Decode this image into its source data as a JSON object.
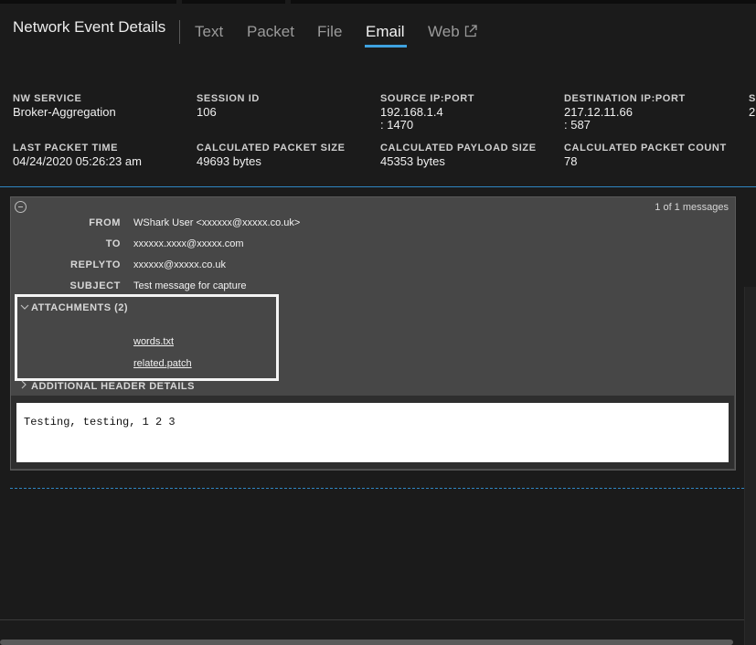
{
  "header": {
    "title": "Network Event Details",
    "tabs": [
      {
        "label": "Text",
        "active": false
      },
      {
        "label": "Packet",
        "active": false
      },
      {
        "label": "File",
        "active": false
      },
      {
        "label": "Email",
        "active": true
      },
      {
        "label": "Web",
        "active": false,
        "icon": "external-link-icon"
      }
    ],
    "accent_color": "#3fa2e0"
  },
  "meta": {
    "nw_service": {
      "label": "NW SERVICE",
      "value": "Broker-Aggregation"
    },
    "session_id": {
      "label": "SESSION ID",
      "value": "106"
    },
    "source_ip_port": {
      "label": "SOURCE IP:PORT",
      "ip": "192.168.1.4",
      "port": ": 1470"
    },
    "destination_ip_port": {
      "label": "DESTINATION IP:PORT",
      "ip": "217.12.11.66",
      "port": ": 587"
    },
    "cut_label": "S",
    "cut_value": "2",
    "last_packet_time": {
      "label": "LAST PACKET TIME",
      "value": "04/24/2020 05:26:23 am"
    },
    "calc_packet_size": {
      "label": "CALCULATED PACKET SIZE",
      "value": "49693 bytes"
    },
    "calc_payload_size": {
      "label": "CALCULATED PAYLOAD SIZE",
      "value": "45353 bytes"
    },
    "calc_packet_count": {
      "label": "CALCULATED PACKET COUNT",
      "value": "78"
    }
  },
  "email": {
    "message_count": "1 of 1 messages",
    "headers": {
      "from": {
        "label": "FROM",
        "value": "WShark User <xxxxxx@xxxxx.co.uk>"
      },
      "to": {
        "label": "TO",
        "value": "xxxxxx.xxxx@xxxxx.com"
      },
      "replyto": {
        "label": "REPLYTO",
        "value": "xxxxxx@xxxxx.co.uk"
      },
      "subject": {
        "label": "SUBJECT",
        "value": "Test message for capture"
      }
    },
    "attachments": {
      "label": "ATTACHMENTS (2)",
      "expanded": true,
      "items": [
        "words.txt",
        "related.patch"
      ]
    },
    "additional_header": {
      "label": "ADDITIONAL HEADER DETAILS",
      "expanded": false
    },
    "body": "Testing, testing, 1 2 3"
  }
}
